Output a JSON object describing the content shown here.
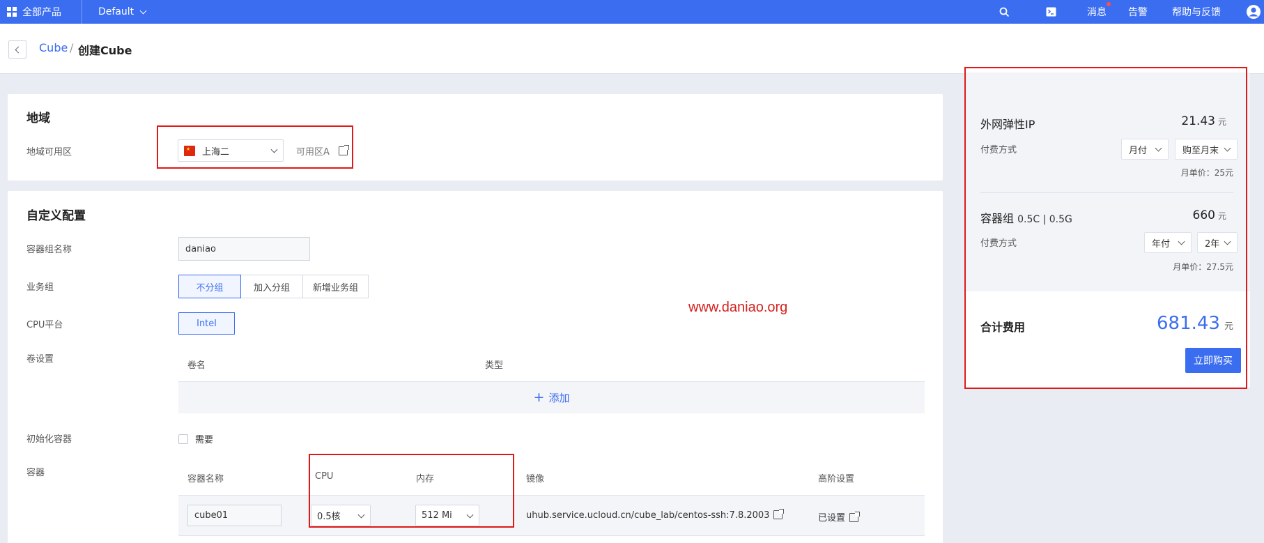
{
  "topbar": {
    "all_products": "全部产品",
    "project": "Default",
    "messages": "消息",
    "alerts": "告警",
    "help": "帮助与反馈"
  },
  "breadcrumb": {
    "parent": "Cube",
    "separator": "/",
    "current": "创建Cube"
  },
  "region": {
    "title": "地域",
    "zone_label": "地域可用区",
    "region_value": "上海二",
    "zone_value": "可用区A"
  },
  "config": {
    "title": "自定义配置",
    "name_label": "容器组名称",
    "name_value": "daniao",
    "group_label": "业务组",
    "group_options": [
      "不分组",
      "加入分组",
      "新增业务组"
    ],
    "cpu_platform_label": "CPU平台",
    "cpu_platform_value": "Intel",
    "volume_label": "卷设置",
    "volume_columns": [
      "卷名",
      "类型"
    ],
    "volume_add": "添加",
    "init_container_label": "初始化容器",
    "init_container_checkbox": "需要",
    "container_label": "容器",
    "container_columns": [
      "容器名称",
      "CPU",
      "内存",
      "镜像",
      "高阶设置"
    ],
    "container_row": {
      "name": "cube01",
      "cpu": "0.5核",
      "memory": "512 Mi",
      "image": "uhub.service.ucloud.cn/cube_lab/centos-ssh:7.8.2003",
      "advanced": "已设置"
    }
  },
  "watermark": "www.daniao.org",
  "pricing": {
    "eip": {
      "title": "外网弹性IP",
      "price": "21.43",
      "currency": "元",
      "pay_label": "付费方式",
      "pay_mode": "月付",
      "pay_period": "购至月末",
      "unit_price": "月单价：25元"
    },
    "pod": {
      "title": "容器组",
      "spec": "0.5C | 0.5G",
      "price": "660",
      "currency": "元",
      "pay_label": "付费方式",
      "pay_mode": "年付",
      "pay_period": "2年",
      "unit_price": "月单价：27.5元"
    },
    "total_label": "合计费用",
    "total_price": "681.43",
    "total_currency": "元",
    "buy_button": "立即购买"
  },
  "colors": {
    "brand": "#3b6df0",
    "highlight_border": "#e01818",
    "watermark": "#d4201c"
  }
}
